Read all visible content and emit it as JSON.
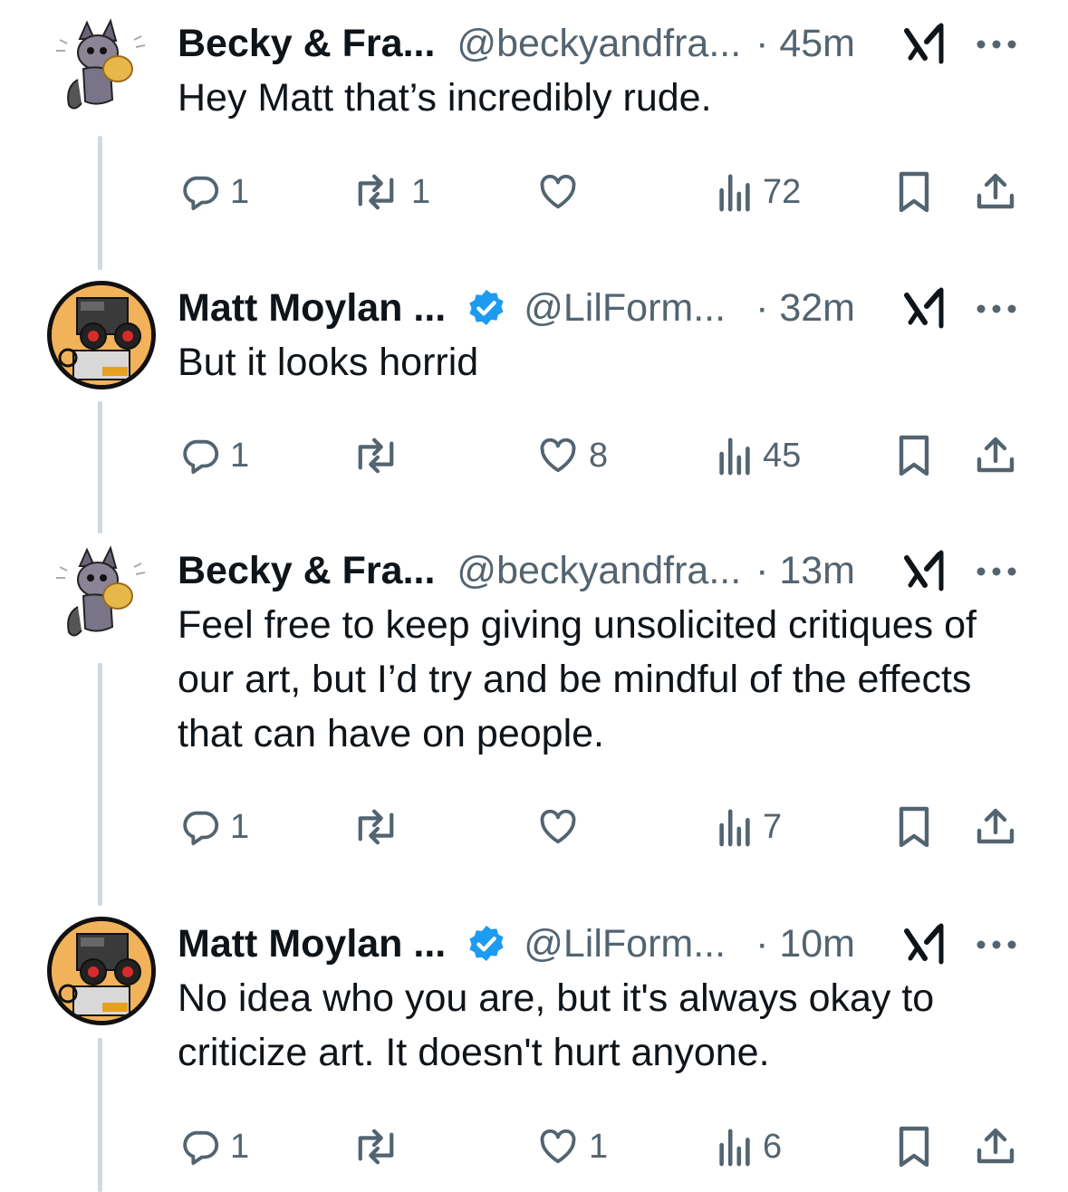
{
  "tweets": [
    {
      "name": "Becky & Fra...",
      "handle": "@beckyandfra...",
      "time": "· 45m",
      "verified": false,
      "avatar": "cat-avatar",
      "text": "Hey Matt that’s incredibly rude.",
      "replies": "1",
      "reposts": "1",
      "likes": "",
      "views": "72"
    },
    {
      "name": "Matt Moylan ...",
      "handle": "@LilForm...",
      "time": "· 32m",
      "verified": true,
      "avatar": "robot-avatar",
      "text": "But it looks horrid",
      "replies": "1",
      "reposts": "",
      "likes": "8",
      "views": "45"
    },
    {
      "name": "Becky & Fra...",
      "handle": "@beckyandfra...",
      "time": "· 13m",
      "verified": false,
      "avatar": "cat-avatar",
      "text": "Feel free to keep giving unsolicited critiques of our art, but I’d try and be mindful of the effects that can have on people.",
      "replies": "1",
      "reposts": "",
      "likes": "",
      "views": "7"
    },
    {
      "name": "Matt Moylan ...",
      "handle": "@LilForm...",
      "time": "· 10m",
      "verified": true,
      "avatar": "robot-avatar",
      "text": "No idea who you are, but it's always okay to criticize art. It doesn't hurt anyone.",
      "replies": "1",
      "reposts": "",
      "likes": "1",
      "views": "6"
    }
  ],
  "colors": {
    "text": "#0f1419",
    "muted": "#536471",
    "verified": "#1d9bf0",
    "thread_line": "#cfd9de"
  }
}
